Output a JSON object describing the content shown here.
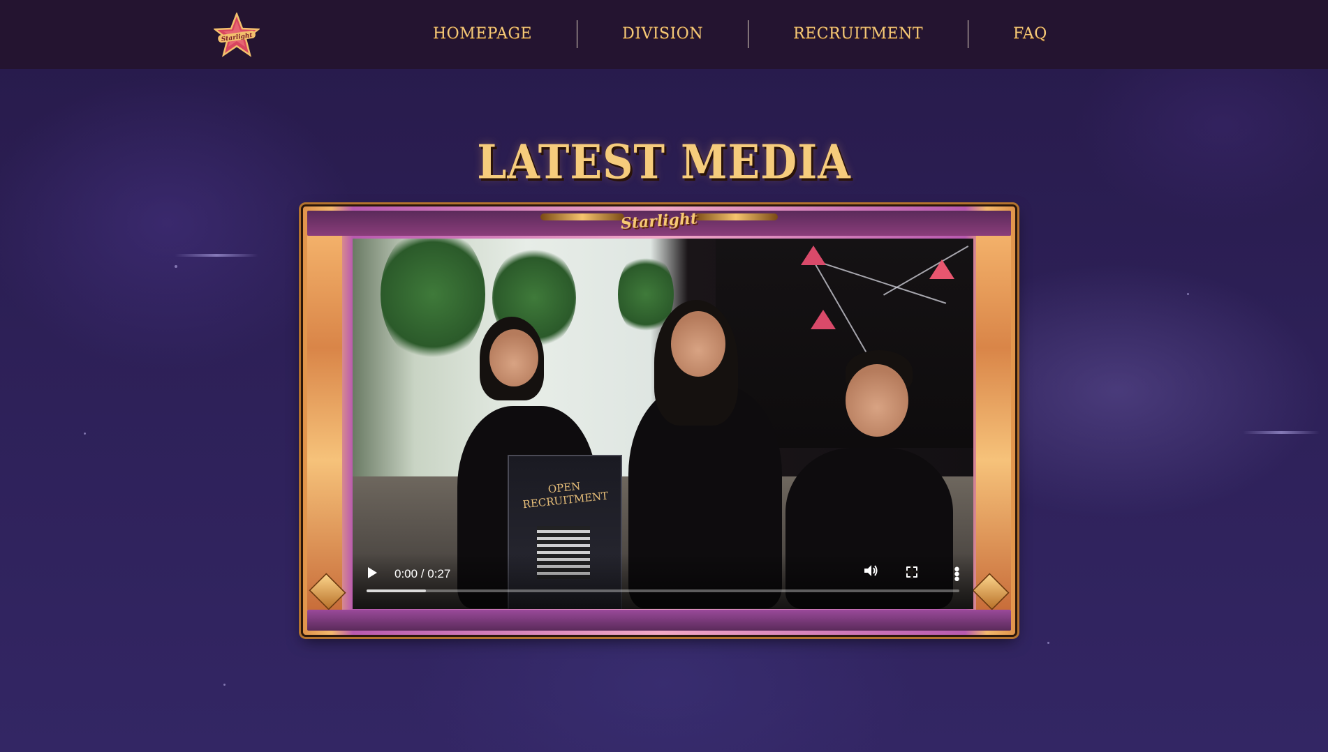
{
  "header": {
    "logo_icon": "starlight-star-logo",
    "nav": [
      "HOMEPAGE",
      "DIVISION",
      "RECRUITMENT",
      "FAQ"
    ]
  },
  "section": {
    "title": "LATEST MEDIA"
  },
  "frame": {
    "logo_text": "Starlight"
  },
  "video": {
    "time": "0:00 / 0:27",
    "buffered": 0.1,
    "standee_text": "OPEN RECRUITMENT",
    "controls": [
      "play-icon",
      "volume-icon",
      "fullscreen-icon",
      "more-options-icon"
    ]
  },
  "colors": {
    "header_bg": "#241430",
    "nav_text": "#f4c97a",
    "title_text": "#f6cc7c",
    "page_bg": "#2d2057"
  }
}
